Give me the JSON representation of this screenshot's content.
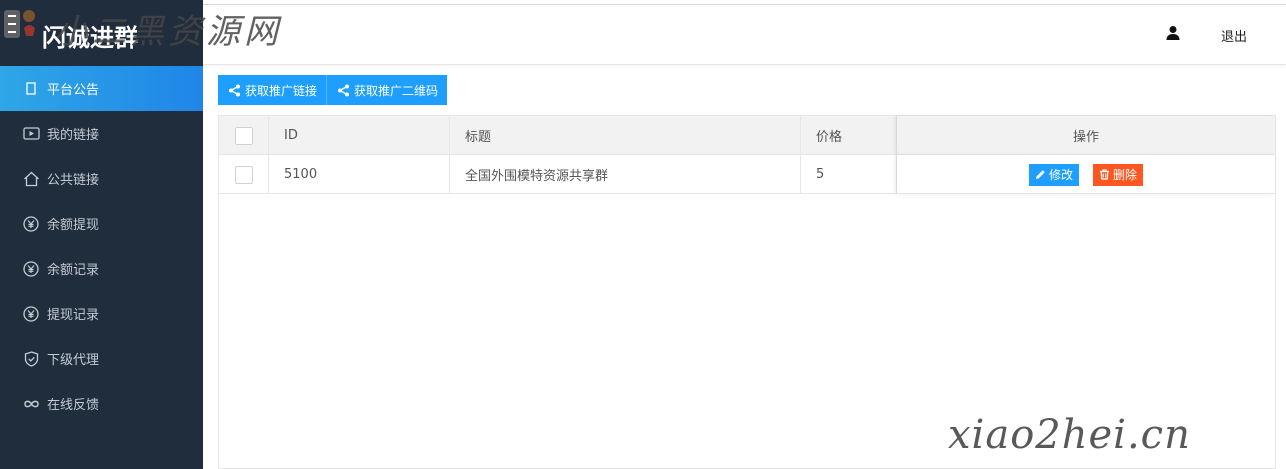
{
  "app": {
    "title": "闪诚进群"
  },
  "watermark": {
    "top_text": "小二黑资源网",
    "bottom_text": "xiao2hei.cn"
  },
  "header": {
    "user_icon": "user-icon",
    "logout_label": "退出"
  },
  "sidebar": {
    "items": [
      {
        "label": "平台公告",
        "icon": "notice-icon",
        "active": true
      },
      {
        "label": "我的链接",
        "icon": "video-icon",
        "active": false
      },
      {
        "label": "公共链接",
        "icon": "home-icon",
        "active": false
      },
      {
        "label": "余额提现",
        "icon": "yuan-icon",
        "active": false
      },
      {
        "label": "余额记录",
        "icon": "yuan-icon",
        "active": false
      },
      {
        "label": "提现记录",
        "icon": "yuan-icon",
        "active": false
      },
      {
        "label": "下级代理",
        "icon": "shield-check-icon",
        "active": false
      },
      {
        "label": "在线反馈",
        "icon": "infinity-icon",
        "active": false
      }
    ]
  },
  "toolbar": {
    "get_link_label": "获取推广链接",
    "get_qrcode_label": "获取推广二维码"
  },
  "table": {
    "columns": [
      "ID",
      "标题",
      "价格",
      "操作"
    ],
    "rows": [
      {
        "id": "5100",
        "title": "全国外围模特资源共享群",
        "price": "5"
      }
    ],
    "edit_label": "修改",
    "delete_label": "删除"
  },
  "colors": {
    "sidebar_bg": "#1f2d3d",
    "active_item": "#1e9fff",
    "primary": "#1e9fff",
    "danger": "#ff5722"
  }
}
